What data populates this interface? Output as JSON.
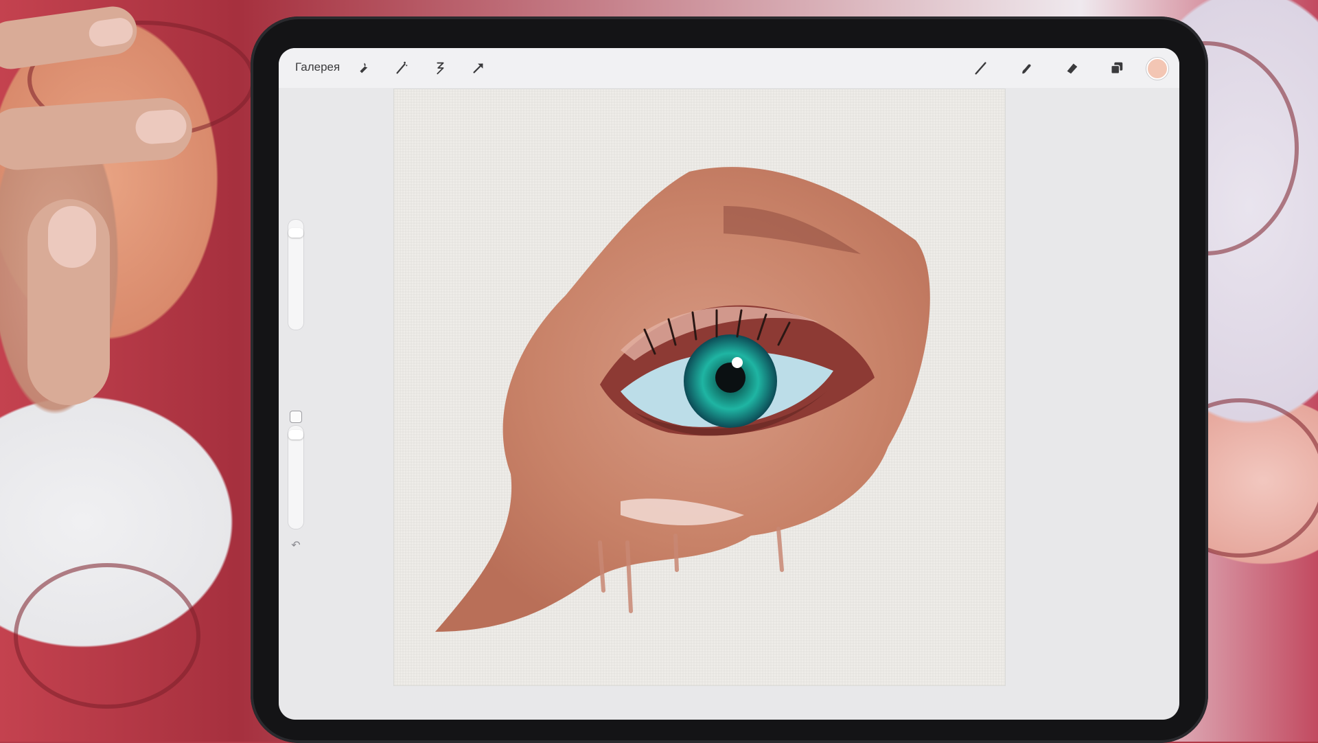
{
  "app": {
    "gallery_label": "Галерея"
  },
  "toolbar": {
    "left_tools": [
      "wrench-icon",
      "magic-wand-icon",
      "selection-icon",
      "transform-arrow-icon"
    ],
    "right_tools": [
      "brush-icon",
      "smudge-icon",
      "eraser-icon",
      "layers-icon"
    ],
    "current_color": "#f3c6b4"
  },
  "sidebar": {
    "size_slider_icon": "brush-size-slider",
    "opacity_slider_icon": "opacity-slider",
    "undo_glyph": "↶",
    "redo_glyph": "↷"
  },
  "canvas": {
    "subject": "painted-eye"
  }
}
